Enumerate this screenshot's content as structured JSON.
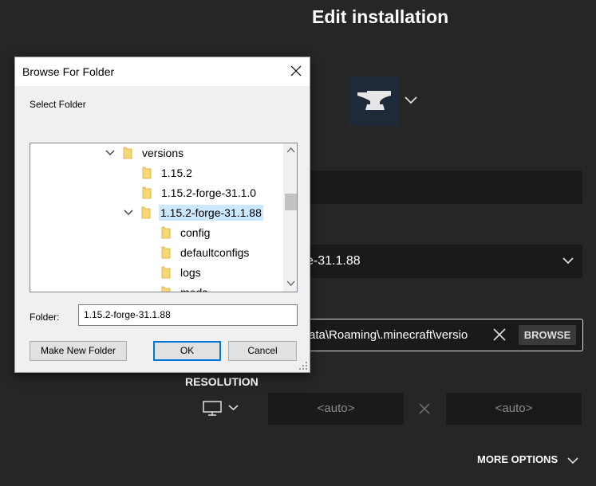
{
  "launcher": {
    "title": "Edit installation",
    "version_value": "e-31.1.88",
    "game_directory_value": "ata\\Roaming\\.minecraft\\versio",
    "browse_label": "BROWSE",
    "resolution_label": "RESOLUTION",
    "width_placeholder": "<auto>",
    "height_placeholder": "<auto>",
    "more_options_label": "MORE OPTIONS",
    "installation_icon": "anvil-icon"
  },
  "dialog": {
    "title": "Browse For Folder",
    "subtitle": "Select Folder",
    "tree": [
      {
        "label": "versions",
        "expanded": true,
        "selected": false
      },
      {
        "label": "1.15.2",
        "expanded": false,
        "selected": false
      },
      {
        "label": "1.15.2-forge-31.1.0",
        "expanded": false,
        "selected": false
      },
      {
        "label": "1.15.2-forge-31.1.88",
        "expanded": true,
        "selected": true
      },
      {
        "label": "config",
        "expanded": false,
        "selected": false
      },
      {
        "label": "defaultconfigs",
        "expanded": false,
        "selected": false
      },
      {
        "label": "logs",
        "expanded": false,
        "selected": false
      },
      {
        "label": "mods",
        "expanded": false,
        "selected": false
      }
    ],
    "folder_label": "Folder:",
    "folder_value": "1.15.2-forge-31.1.88",
    "make_new_folder_label": "Make New Folder",
    "ok_label": "OK",
    "cancel_label": "Cancel"
  },
  "colors": {
    "background": "#262626",
    "field": "#1a1a1a",
    "selection": "#cce8ff",
    "default_button_border": "#0078d7",
    "folder_yellow": "#f8d775"
  }
}
